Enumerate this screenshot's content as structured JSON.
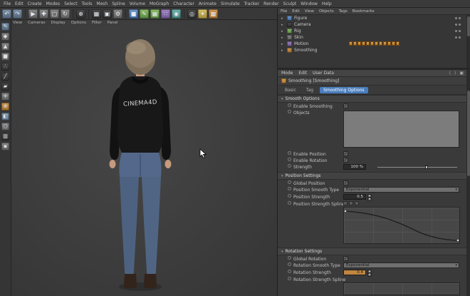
{
  "menubar": {
    "items": [
      "File",
      "Edit",
      "Create",
      "Modes",
      "Select",
      "Tools",
      "Mesh",
      "Spline",
      "Volume",
      "MoGraph",
      "Character",
      "Animate",
      "Simulate",
      "Tracker",
      "Render",
      "Sculpt",
      "Window",
      "Help"
    ]
  },
  "viewport": {
    "menu": [
      "View",
      "Cameras",
      "Display",
      "Options",
      "Filter",
      "Panel"
    ],
    "jacket_text": "CINEMA4D"
  },
  "object_manager": {
    "menu": [
      "File",
      "Edit",
      "View",
      "Objects",
      "Tags",
      "Bookmarks"
    ],
    "items": [
      {
        "name": "Figure"
      },
      {
        "name": "Camera"
      },
      {
        "name": "Rig"
      },
      {
        "name": "Skin"
      },
      {
        "name": "Motion"
      },
      {
        "name": "Smoothing"
      }
    ]
  },
  "attributes": {
    "menu": [
      "Mode",
      "Edit",
      "User Data"
    ],
    "object_title": "Smoothing [Smoothing]",
    "tabs": [
      {
        "label": "Basic"
      },
      {
        "label": "Tag"
      },
      {
        "label": "Smoothing Options"
      }
    ],
    "sections": {
      "smooth": {
        "title": "Smooth Options",
        "enable_smoothing": "Enable Smoothing",
        "objects_label": "Objects",
        "enable_position": "Enable Position",
        "enable_rotation": "Enable Rotation",
        "strength_label": "Strength",
        "strength_value": "100 %"
      },
      "position": {
        "title": "Position Settings",
        "global_label": "Global Position",
        "type_label": "Position Smooth Type",
        "type_value": "Exponential",
        "strength_label": "Position Strength",
        "strength_value": "0.5",
        "curve_label": "Position Strength Spline"
      },
      "rotation": {
        "title": "Rotation Settings",
        "global_label": "Global Rotation",
        "type_label": "Rotation Smooth Type",
        "type_value": "Exponential",
        "strength_label": "Rotation Strength",
        "strength_value": "0.4",
        "curve_label": "Rotation Strength Spline"
      }
    },
    "curve_points": [
      [
        0,
        0.95
      ],
      [
        0.3,
        0.8
      ],
      [
        0.62,
        0.35
      ],
      [
        1,
        0.08
      ]
    ]
  }
}
